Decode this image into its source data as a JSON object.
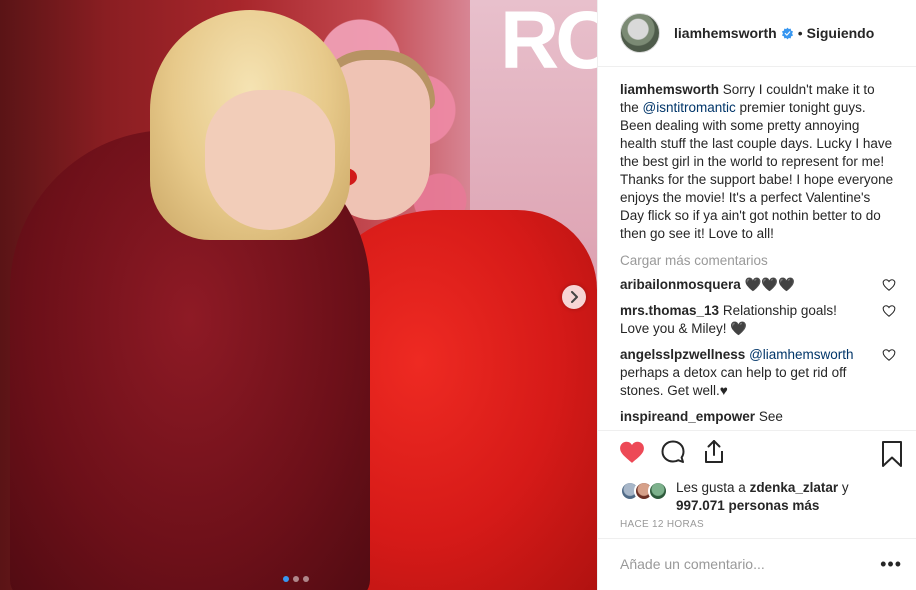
{
  "photo": {
    "sign_text": "RO",
    "next_label": "›",
    "dots": [
      true,
      false,
      false
    ]
  },
  "header": {
    "username": "liamhemsworth",
    "separator": "•",
    "follow_label": "Siguiendo"
  },
  "caption": {
    "username": "liamhemsworth",
    "pre": "Sorry I couldn't make it to the ",
    "mention": "@isntitromantic",
    "post": " premier tonight guys. Been dealing with some pretty annoying health stuff the last couple days. Lucky I have the best girl in the world to represent for me! Thanks for the support babe! I hope everyone enjoys the movie! It's a perfect Valentine's Day flick so if ya ain't got nothin better to do then go see it! Love to all!"
  },
  "load_more": "Cargar más comentarios",
  "comments": [
    {
      "username": "aribailonmosquera",
      "text": "🖤🖤🖤"
    },
    {
      "username": "mrs.thomas_13",
      "text": "Relationship goals! Love you & Miley! 🖤"
    },
    {
      "username": "angelsslpzwellness",
      "mention": "@liamhemsworth",
      "text": "perhaps a detox can help to get rid off stones. Get well.♥"
    },
    {
      "username": "inspireand_empower",
      "text": "See"
    }
  ],
  "likes": {
    "prefix": "Les gusta a ",
    "user": "zdenka_zlatar",
    "middle": " y ",
    "count": "997.071 personas más"
  },
  "time": "HACE 12 HORAS",
  "add_comment": {
    "placeholder": "Añade un comentario...",
    "more": "•••"
  },
  "colors": {
    "heart_liked": "#ed4956",
    "verified": "#3897f0",
    "mention": "#003569",
    "muted": "#999999"
  }
}
